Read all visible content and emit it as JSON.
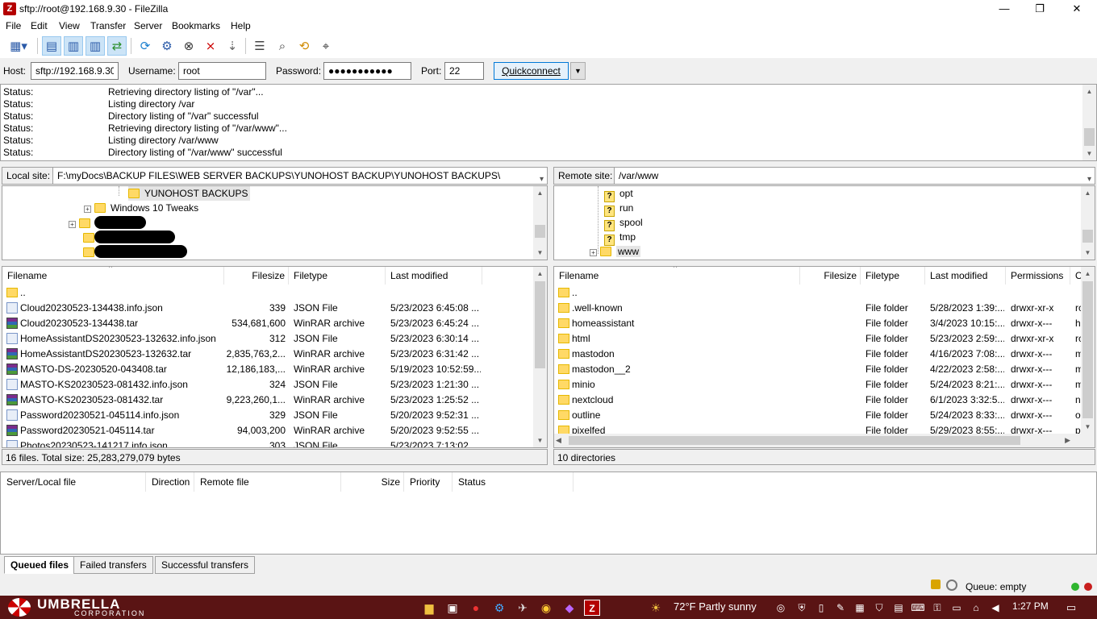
{
  "window": {
    "title": "sftp://root@192.168.9.30 - FileZilla",
    "app_icon": "filezilla-icon",
    "controls": {
      "minimize": "—",
      "maximize": "❐",
      "close": "✕"
    }
  },
  "menu": [
    "File",
    "Edit",
    "View",
    "Transfer",
    "Server",
    "Bookmarks",
    "Help"
  ],
  "toolbar": {
    "icons": [
      "site-manager-icon",
      "toggle-log-icon",
      "toggle-local-tree-icon",
      "toggle-remote-tree-icon",
      "toggle-queue-icon",
      "refresh-icon",
      "process-queue-icon",
      "cancel-icon",
      "disconnect-icon",
      "reconnect-icon",
      "filter-icon",
      "toggle-compare-icon",
      "sync-browse-icon",
      "search-icon"
    ]
  },
  "quickconnect": {
    "host_label": "Host:",
    "host_value": "sftp://192.168.9.30",
    "username_label": "Username:",
    "username_value": "root",
    "password_label": "Password:",
    "password_value": "●●●●●●●●●●●",
    "port_label": "Port:",
    "port_value": "22",
    "button": "Quickconnect",
    "dropdown": "▼"
  },
  "log": [
    {
      "key": "Status:",
      "msg": "Retrieving directory listing of \"/var\"..."
    },
    {
      "key": "Status:",
      "msg": "Listing directory /var"
    },
    {
      "key": "Status:",
      "msg": "Directory listing of \"/var\" successful"
    },
    {
      "key": "Status:",
      "msg": "Retrieving directory listing of \"/var/www\"..."
    },
    {
      "key": "Status:",
      "msg": "Listing directory /var/www"
    },
    {
      "key": "Status:",
      "msg": "Directory listing of \"/var/www\" successful"
    }
  ],
  "local": {
    "site_label": "Local site:",
    "path": "F:\\myDocs\\BACKUP FILES\\WEB SERVER BACKUPS\\YUNOHOST BACKUP\\YUNOHOST BACKUPS\\",
    "tree": [
      {
        "label": "YUNOHOST BACKUPS"
      },
      {
        "label": "Windows 10 Tweaks"
      }
    ],
    "columns": [
      "Filename",
      "Filesize",
      "Filetype",
      "Last modified"
    ],
    "files": [
      {
        "name": "..",
        "size": "",
        "type": "",
        "modified": "",
        "icon": "dir"
      },
      {
        "name": "Cloud20230523-134438.info.json",
        "size": "339",
        "type": "JSON File",
        "modified": "5/23/2023 6:45:08 ...",
        "icon": "json"
      },
      {
        "name": "Cloud20230523-134438.tar",
        "size": "534,681,600",
        "type": "WinRAR archive",
        "modified": "5/23/2023 6:45:24 ...",
        "icon": "tar"
      },
      {
        "name": "HomeAssistantDS20230523-132632.info.json",
        "size": "312",
        "type": "JSON File",
        "modified": "5/23/2023 6:30:14 ...",
        "icon": "json"
      },
      {
        "name": "HomeAssistantDS20230523-132632.tar",
        "size": "2,835,763,2...",
        "type": "WinRAR archive",
        "modified": "5/23/2023 6:31:42 ...",
        "icon": "tar"
      },
      {
        "name": "MASTO-DS-20230520-043408.tar",
        "size": "12,186,183,...",
        "type": "WinRAR archive",
        "modified": "5/19/2023 10:52:59...",
        "icon": "tar"
      },
      {
        "name": "MASTO-KS20230523-081432.info.json",
        "size": "324",
        "type": "JSON File",
        "modified": "5/23/2023 1:21:30 ...",
        "icon": "json"
      },
      {
        "name": "MASTO-KS20230523-081432.tar",
        "size": "9,223,260,1...",
        "type": "WinRAR archive",
        "modified": "5/23/2023 1:25:52 ...",
        "icon": "tar"
      },
      {
        "name": "Password20230521-045114.info.json",
        "size": "329",
        "type": "JSON File",
        "modified": "5/20/2023 9:52:31 ...",
        "icon": "json"
      },
      {
        "name": "Password20230521-045114.tar",
        "size": "94,003,200",
        "type": "WinRAR archive",
        "modified": "5/20/2023 9:52:55 ...",
        "icon": "tar"
      },
      {
        "name": "Photos20230523-141217.info.json",
        "size": "303",
        "type": "JSON File",
        "modified": "5/23/2023 7:13:02 ...",
        "icon": "json"
      }
    ],
    "status": "16 files. Total size: 25,283,279,079 bytes"
  },
  "remote": {
    "site_label": "Remote site:",
    "path": "/var/www",
    "tree": [
      {
        "label": "opt"
      },
      {
        "label": "run"
      },
      {
        "label": "spool"
      },
      {
        "label": "tmp"
      },
      {
        "label": "www"
      }
    ],
    "columns": [
      "Filename",
      "Filesize",
      "Filetype",
      "Last modified",
      "Permissions",
      "O"
    ],
    "files": [
      {
        "name": "..",
        "type": "",
        "modified": "",
        "perms": "",
        "owner": ""
      },
      {
        "name": ".well-known",
        "type": "File folder",
        "modified": "5/28/2023 1:39:...",
        "perms": "drwxr-xr-x",
        "owner": "rc"
      },
      {
        "name": "homeassistant",
        "type": "File folder",
        "modified": "3/4/2023 10:15:...",
        "perms": "drwxr-x---",
        "owner": "hc"
      },
      {
        "name": "html",
        "type": "File folder",
        "modified": "5/23/2023 2:59:...",
        "perms": "drwxr-xr-x",
        "owner": "rc"
      },
      {
        "name": "mastodon",
        "type": "File folder",
        "modified": "4/16/2023 7:08:...",
        "perms": "drwxr-x---",
        "owner": "m"
      },
      {
        "name": "mastodon__2",
        "type": "File folder",
        "modified": "4/22/2023 2:58:...",
        "perms": "drwxr-x---",
        "owner": "m"
      },
      {
        "name": "minio",
        "type": "File folder",
        "modified": "5/24/2023 8:21:...",
        "perms": "drwxr-x---",
        "owner": "m"
      },
      {
        "name": "nextcloud",
        "type": "File folder",
        "modified": "6/1/2023 3:32:5...",
        "perms": "drwxr-x---",
        "owner": "nc"
      },
      {
        "name": "outline",
        "type": "File folder",
        "modified": "5/24/2023 8:33:...",
        "perms": "drwxr-x---",
        "owner": "ou"
      },
      {
        "name": "pixelfed",
        "type": "File folder",
        "modified": "5/29/2023 8:55:...",
        "perms": "drwxr-x---",
        "owner": "pi"
      }
    ],
    "status": "10 directories"
  },
  "queue": {
    "columns": [
      "Server/Local file",
      "Direction",
      "Remote file",
      "Size",
      "Priority",
      "Status"
    ],
    "tabs": [
      "Queued files",
      "Failed transfers",
      "Successful transfers"
    ],
    "queue_status": "Queue: empty"
  },
  "taskbar": {
    "logo_title": "UMBRELLA",
    "logo_subtitle": "CORPORATION",
    "weather": "72°F  Partly sunny",
    "time": "1:27 PM"
  }
}
